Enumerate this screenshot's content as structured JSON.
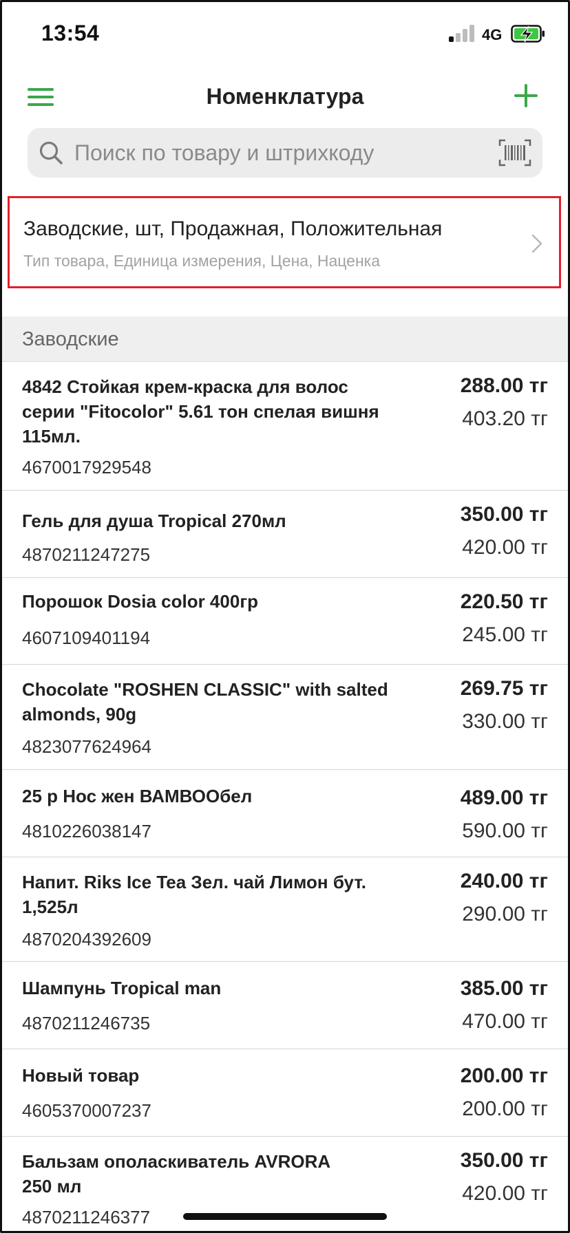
{
  "status": {
    "time": "13:54",
    "network": "4G"
  },
  "header": {
    "title": "Номенклатура",
    "menu_icon": "hamburger-icon",
    "add_icon": "plus-icon"
  },
  "search": {
    "placeholder": "Поиск по товару и штрихкоду",
    "value": ""
  },
  "filter": {
    "title": "Заводские, шт, Продажная, Положительная",
    "subtitle": "Тип товара, Единица измерения, Цена, Наценка"
  },
  "section": {
    "label": "Заводские"
  },
  "products": [
    {
      "name": "4842 Стойкая крем-краска для волос серии \"Fitocolor\" 5.61 тон спелая вишня 115мл.",
      "code": "4670017929548",
      "price": "288.00 тг",
      "price2": "403.20 тг"
    },
    {
      "name": "Гель для душа Tropical 270мл",
      "code": "4870211247275",
      "price": "350.00 тг",
      "price2": "420.00 тг"
    },
    {
      "name": "Порошок Dosia color 400гр",
      "code": "4607109401194",
      "price": "220.50 тг",
      "price2": "245.00 тг"
    },
    {
      "name": "Chocolate \"ROSHEN CLASSIC\" with salted almonds, 90g",
      "code": "4823077624964",
      "price": "269.75 тг",
      "price2": "330.00 тг"
    },
    {
      "name": "25 р Нос жен ВАМВООбел",
      "code": "4810226038147",
      "price": "489.00 тг",
      "price2": "590.00 тг"
    },
    {
      "name": "Напит. Riks Ice Tea Зел. чай Лимон бут. 1,525л",
      "code": "4870204392609",
      "price": "240.00 тг",
      "price2": "290.00 тг"
    },
    {
      "name": "Шампунь Tropical man",
      "code": "4870211246735",
      "price": "385.00 тг",
      "price2": "470.00 тг"
    },
    {
      "name": "Новый товар",
      "code": "4605370007237",
      "price": "200.00 тг",
      "price2": "200.00 тг"
    },
    {
      "name": "Бальзам ополаскиватель AVRORA 250 мл",
      "code": "4870211246377",
      "price": "350.00 тг",
      "price2": "420.00 тг"
    }
  ],
  "colors": {
    "accent": "#3aa84a",
    "highlight_border": "#e0202a",
    "section_bg": "#efefef"
  }
}
